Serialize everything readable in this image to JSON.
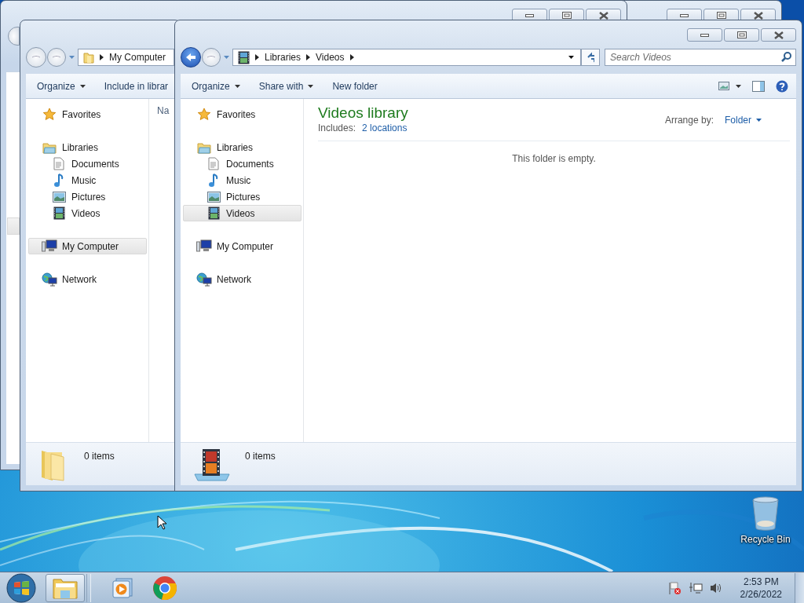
{
  "windows": [
    {
      "back_enabled": false,
      "address": {
        "kind": "folder",
        "crumbs": [
          "My Computer"
        ],
        "trailing_arrow": false
      },
      "toolbar": [
        {
          "label": "Organize",
          "dropdown": true
        },
        {
          "label": "Include in librar",
          "dropdown": false
        }
      ],
      "navigation": [
        {
          "label": "Favorites",
          "kind": "favorites",
          "selected": false
        },
        {
          "label": "Libraries",
          "kind": "libraries",
          "selected": false,
          "children": [
            {
              "label": "Documents",
              "kind": "documents",
              "selected": false
            },
            {
              "label": "Music",
              "kind": "music",
              "selected": false
            },
            {
              "label": "Pictures",
              "kind": "pictures",
              "selected": false
            },
            {
              "label": "Videos",
              "kind": "videos",
              "selected": false
            }
          ]
        },
        {
          "label": "My Computer",
          "kind": "computer",
          "selected": true
        },
        {
          "label": "Network",
          "kind": "network",
          "selected": false
        }
      ],
      "column_header": "Na",
      "status": {
        "kind": "folder",
        "text": "0 items"
      }
    },
    {
      "back_enabled": true,
      "caption_buttons": true,
      "address": {
        "kind": "videos",
        "crumbs": [
          "Libraries",
          "Videos"
        ],
        "trailing_arrow": true
      },
      "search": {
        "placeholder": "Search Videos"
      },
      "toolbar": [
        {
          "label": "Organize",
          "dropdown": true
        },
        {
          "label": "Share with",
          "dropdown": true
        },
        {
          "label": "New folder",
          "dropdown": false
        }
      ],
      "view_controls": true,
      "navigation": [
        {
          "label": "Favorites",
          "kind": "favorites",
          "selected": false
        },
        {
          "label": "Libraries",
          "kind": "libraries",
          "selected": false,
          "children": [
            {
              "label": "Documents",
              "kind": "documents",
              "selected": false
            },
            {
              "label": "Music",
              "kind": "music",
              "selected": false
            },
            {
              "label": "Pictures",
              "kind": "pictures",
              "selected": false
            },
            {
              "label": "Videos",
              "kind": "videos",
              "selected": true
            }
          ]
        },
        {
          "label": "My Computer",
          "kind": "computer",
          "selected": false
        },
        {
          "label": "Network",
          "kind": "network",
          "selected": false
        }
      ],
      "library": {
        "title": "Videos library",
        "includes_label": "Includes:",
        "includes_link": "2 locations",
        "arrange_label": "Arrange by:",
        "arrange_value": "Folder",
        "empty_message": "This folder is empty."
      },
      "status": {
        "kind": "video-library",
        "text": "0 items"
      }
    }
  ],
  "desktop_icons": [
    {
      "label": "Recycle Bin",
      "kind": "recycle-bin"
    }
  ],
  "taskbar": {
    "buttons": [
      {
        "kind": "explorer",
        "selected": true
      },
      {
        "kind": "media-player",
        "selected": false
      },
      {
        "kind": "browser",
        "selected": false
      }
    ],
    "clock": {
      "time": "2:53 PM",
      "date": "2/26/2022"
    }
  }
}
